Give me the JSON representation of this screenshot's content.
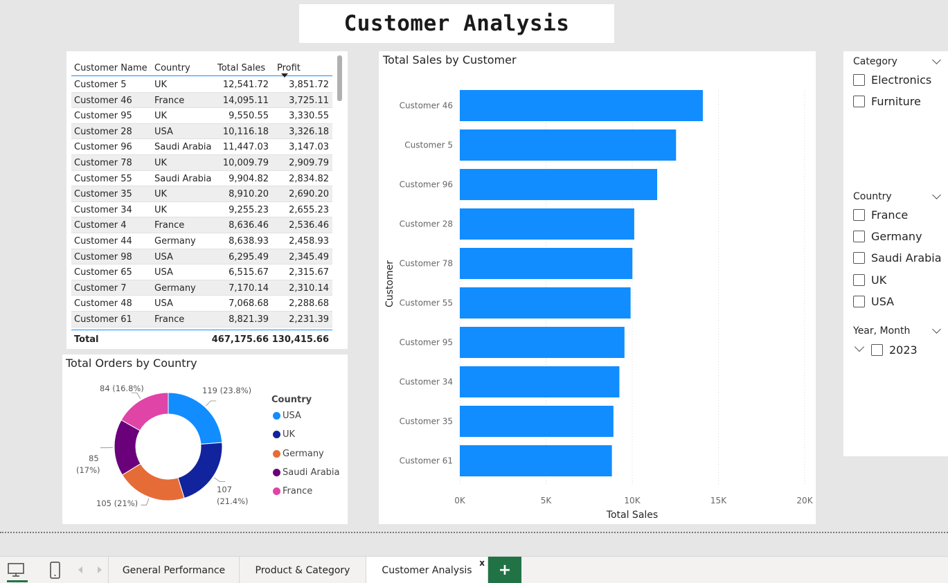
{
  "header": {
    "title": "Customer Analysis"
  },
  "table": {
    "columns": [
      "Customer Name",
      "Country",
      "Total Sales",
      "Profit"
    ],
    "rows": [
      [
        "Customer 5",
        "UK",
        "12,541.72",
        "3,851.72"
      ],
      [
        "Customer 46",
        "France",
        "14,095.11",
        "3,725.11"
      ],
      [
        "Customer 95",
        "UK",
        "9,550.55",
        "3,330.55"
      ],
      [
        "Customer 28",
        "USA",
        "10,116.18",
        "3,326.18"
      ],
      [
        "Customer 96",
        "Saudi Arabia",
        "11,447.03",
        "3,147.03"
      ],
      [
        "Customer 78",
        "UK",
        "10,009.79",
        "2,909.79"
      ],
      [
        "Customer 55",
        "Saudi Arabia",
        "9,904.82",
        "2,834.82"
      ],
      [
        "Customer 35",
        "UK",
        "8,910.20",
        "2,690.20"
      ],
      [
        "Customer 34",
        "UK",
        "9,255.23",
        "2,655.23"
      ],
      [
        "Customer 4",
        "France",
        "8,636.46",
        "2,536.46"
      ],
      [
        "Customer 44",
        "Germany",
        "8,638.93",
        "2,458.93"
      ],
      [
        "Customer 98",
        "USA",
        "6,295.49",
        "2,345.49"
      ],
      [
        "Customer 65",
        "USA",
        "6,515.67",
        "2,315.67"
      ],
      [
        "Customer 7",
        "Germany",
        "7,170.14",
        "2,310.14"
      ],
      [
        "Customer 48",
        "USA",
        "7,068.68",
        "2,288.68"
      ],
      [
        "Customer 61",
        "France",
        "8,821.39",
        "2,231.39"
      ]
    ],
    "total": {
      "label": "Total",
      "sales": "467,175.66",
      "profit": "130,415.66"
    }
  },
  "donut": {
    "title": "Total Orders by Country",
    "legend_title": "Country",
    "labels": {
      "usa": "119 (23.8%)",
      "uk_value": "107",
      "uk_pct": "(21.4%)",
      "germany": "105 (21%)",
      "saudi_value": "85",
      "saudi_pct": "(17%)",
      "france": "84 (16.8%)"
    }
  },
  "bar_chart": {
    "title": "Total Sales by Customer",
    "xlabel": "Total Sales",
    "ylabel": "Customer",
    "ticks": [
      "0K",
      "5K",
      "10K",
      "15K",
      "20K"
    ]
  },
  "chart_data": [
    {
      "type": "bar",
      "title": "Total Sales by Customer",
      "orientation": "horizontal",
      "categories": [
        "Customer 46",
        "Customer 5",
        "Customer 96",
        "Customer 28",
        "Customer 78",
        "Customer 55",
        "Customer 95",
        "Customer 34",
        "Customer 35",
        "Customer 61"
      ],
      "values": [
        14095.11,
        12541.72,
        11447.03,
        10116.18,
        10009.79,
        9904.82,
        9550.55,
        9255.23,
        8910.2,
        8821.39
      ],
      "xlabel": "Total Sales",
      "ylabel": "Customer",
      "xlim": [
        0,
        20000
      ],
      "grid": true,
      "color": "#118dff"
    },
    {
      "type": "pie",
      "title": "Total Orders by Country",
      "donut": true,
      "categories": [
        "USA",
        "UK",
        "Germany",
        "Saudi Arabia",
        "France"
      ],
      "values": [
        119,
        107,
        105,
        85,
        84
      ],
      "colors": [
        "#118dff",
        "#12239e",
        "#e66c37",
        "#6b007b",
        "#e044a7"
      ],
      "legend_title": "Country",
      "legend": "right"
    }
  ],
  "slicers": {
    "category": {
      "title": "Category",
      "items": [
        "Electronics",
        "Furniture"
      ]
    },
    "country": {
      "title": "Country",
      "items": [
        "France",
        "Germany",
        "Saudi Arabia",
        "UK",
        "USA"
      ]
    },
    "date": {
      "title": "Year, Month",
      "items": [
        "2023"
      ]
    }
  },
  "bottom_bar": {
    "tabs": [
      "General Performance",
      "Product & Category",
      "Customer Analysis"
    ],
    "close_glyph": "x",
    "add_glyph": "+"
  }
}
